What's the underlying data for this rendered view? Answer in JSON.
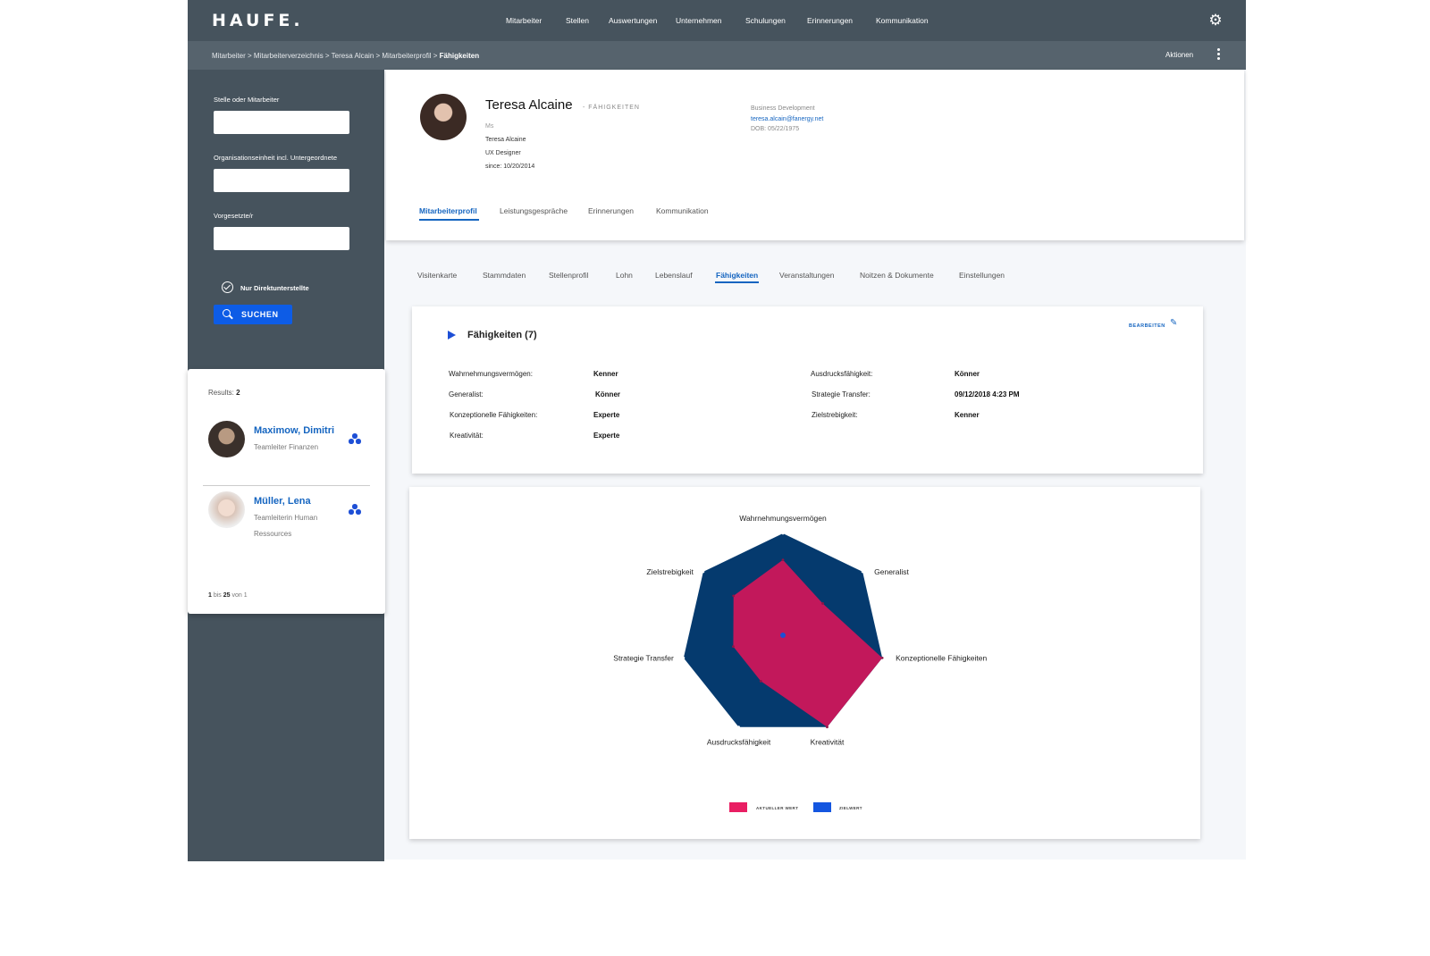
{
  "app": {
    "logo": "HAUFE.",
    "nav": [
      "Mitarbeiter",
      "Stellen",
      "Auswertungen",
      "Unternehmen",
      "Schulungen",
      "Erinnerungen",
      "Kommunikation"
    ],
    "breadcrumb": {
      "path": "Mitarbeiter > Mitarbeiterverzeichnis > Teresa Alcain > Mitarbeiterprofil >",
      "current": "Fähigkeiten"
    },
    "actions_label": "Aktionen",
    "colors": {
      "header": "#46535d",
      "subheader": "#56636d",
      "accent": "#1565c0",
      "button": "#0d5ce6"
    }
  },
  "sidebar": {
    "field1_label": "Stelle oder Mitarbeiter",
    "field1_value": "",
    "field2_label": "Organisationseinheit incl. Untergeordnete",
    "field2_value": "",
    "field3_label": "Vorgesetzte/r",
    "field3_value": "",
    "checkbox_label": "Nur Direktunterstellte",
    "checkbox_checked": true,
    "search_button": "SUCHEN"
  },
  "results": {
    "label": "Results:",
    "count": "2",
    "people": [
      {
        "name": "Maximow, Dimitri",
        "role": "Teamleiter Finanzen"
      },
      {
        "name": "Müller, Lena",
        "role": "Teamleiterin Human Ressources"
      }
    ],
    "pager": {
      "from": "1",
      "word_bis": "bis",
      "to": "25",
      "word_von": "von",
      "total": "1"
    }
  },
  "profile": {
    "name": "Teresa Alcaine",
    "section": "- FÄHIGKEITEN",
    "salutation": "Ms",
    "full_name": "Teresa Alcaine",
    "title": "UX Designer",
    "since": "since: 10/20/2014",
    "department": "Business Development",
    "email": "teresa.alcain@fanergy.net",
    "dob": "DOB: 05/22/1975",
    "tabs": [
      "Mitarbeiterprofil",
      "Leistungsgespräche",
      "Erinnerungen",
      "Kommunikation"
    ],
    "active_tab": "Mitarbeiterprofil"
  },
  "subtabs": {
    "items": [
      "Visitenkarte",
      "Stammdaten",
      "Stellenprofil",
      "Lohn",
      "Lebenslauf",
      "Fähigkeiten",
      "Veranstaltungen",
      "Noitzen & Dokumente",
      "Einstellungen"
    ],
    "active": "Fähigkeiten"
  },
  "skills": {
    "title": "Fähigkeiten (7)",
    "edit_label": "BEARBEITEN",
    "left": [
      {
        "key": "Wahrnehmungsvermögen:",
        "value": "Kenner"
      },
      {
        "key": "Generalist:",
        "value": "Könner"
      },
      {
        "key": "Konzeptionelle Fähigkeiten:",
        "value": "Experte"
      },
      {
        "key": "Kreativität:",
        "value": "Experte"
      }
    ],
    "right": [
      {
        "key": "Ausdrucksfähigkeit:",
        "value": "Könner"
      },
      {
        "key": "Strategie Transfer:",
        "value": "09/12/2018 4:23 PM"
      },
      {
        "key": "Zielstrebigkeit:",
        "value": "Kenner"
      }
    ]
  },
  "chart_data": {
    "type": "radar",
    "axes": [
      "Wahrnehmungsvermögen",
      "Generalist",
      "Konzeptionelle Fähigkeiten",
      "Kreativität",
      "Ausdrucksfähigkeit",
      "Strategie Transfer",
      "Zielstrebigkeit"
    ],
    "rmax": 1,
    "series": [
      {
        "name": "ZIELWERT",
        "color": "#053a6e",
        "values": [
          1,
          1,
          1,
          1,
          1,
          1,
          1
        ]
      },
      {
        "name": "AKTUELLER WERT",
        "color": "#c2185b",
        "values": [
          0.74,
          0.5,
          1,
          1,
          0.5,
          0.5,
          0.62
        ]
      }
    ],
    "legend_position": "bottom",
    "legend_colors": {
      "AKTUELLER WERT": "#e91e63",
      "ZIELWERT": "#1456e0"
    },
    "center_dot_color": "#1d4fd6",
    "grid": false
  }
}
